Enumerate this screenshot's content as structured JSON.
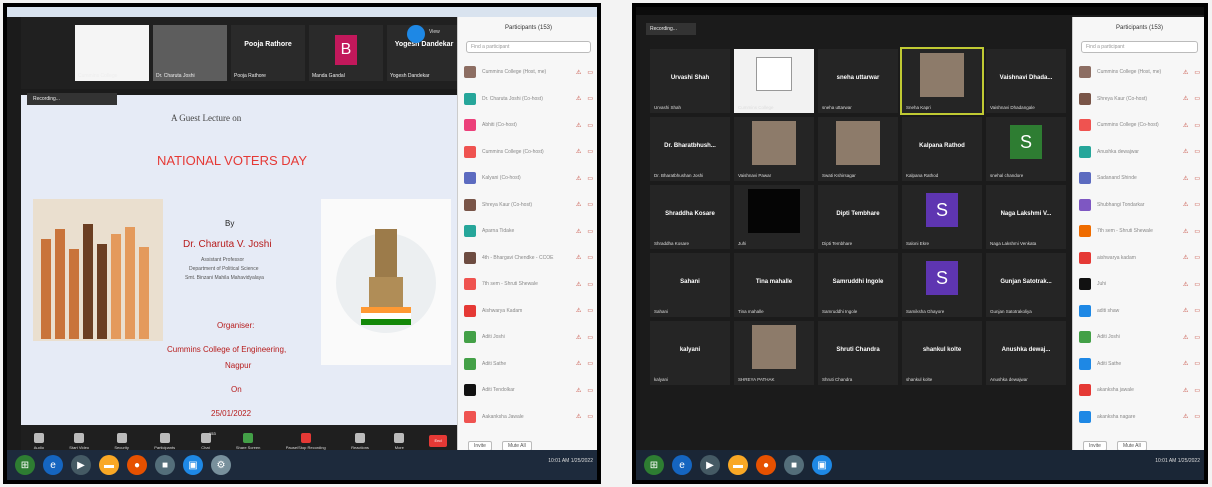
{
  "left": {
    "top_tiles": [
      {
        "name": "Cummins College",
        "big": ""
      },
      {
        "name": "Dr. Charuta Joshi",
        "big": ""
      },
      {
        "name": "Pooja Rathore",
        "big": "Pooja Rathore"
      },
      {
        "name": "Manda Gandal",
        "big": "B"
      },
      {
        "name": "Yogesh Dandekar",
        "big": "Yogesh Dandekar"
      }
    ],
    "view_label": "View",
    "recording_label": "Recording...",
    "slide": {
      "subtitle": "A Guest Lecture on",
      "title": "NATIONAL VOTERS DAY",
      "by": "By",
      "speaker": "Dr. Charuta V. Joshi",
      "designation": "Assistant Professor",
      "department": "Department of Political Science",
      "college": "Smt. Binzani Mahila Mahavidyalaya",
      "organiser_label": "Organiser:",
      "organiser": "Cummins College of Engineering,",
      "city": "Nagpur",
      "on": "On",
      "date": "25/01/2022"
    },
    "controls": [
      "Audio",
      "Start Video",
      "Security",
      "Participants",
      "Chat",
      "Share Screen",
      "Pause/Stop Recording",
      "Reactions",
      "More"
    ],
    "participants_count": "153",
    "end_label": "End",
    "panel": {
      "title": "Participants (153)",
      "search": "Find a participant",
      "rows": [
        {
          "name": "Cummins College (Host, me)",
          "color": "#8d6e63"
        },
        {
          "name": "Dr. Charuta Joshi (Co-host)",
          "color": "#26a69a"
        },
        {
          "name": "Abhiti (Co-host)",
          "color": "#ec407a"
        },
        {
          "name": "Cummins College (Co-host)",
          "color": "#ef5350"
        },
        {
          "name": "Kalyani (Co-host)",
          "color": "#5c6bc0"
        },
        {
          "name": "Shreya Kaur (Co-host)",
          "color": "#795548"
        },
        {
          "name": "Aparna Tidake",
          "color": "#26a69a"
        },
        {
          "name": "4th - Bhargavi Chendke - CCOE",
          "color": "#6d4c41"
        },
        {
          "name": "7th sem - Shruti Shewale",
          "color": "#ef5350"
        },
        {
          "name": "Aishwarya Kadam",
          "color": "#e53935"
        },
        {
          "name": "Aditi Joshi",
          "color": "#43a047"
        },
        {
          "name": "Aditi Sathe",
          "color": "#43a047"
        },
        {
          "name": "Aditi Tendolkar",
          "color": "#111111"
        },
        {
          "name": "Aakanksha Jawale",
          "color": "#ef5350"
        }
      ],
      "invite": "Invite",
      "mute_all": "Mute All"
    }
  },
  "right": {
    "recording_label": "Recording...",
    "grid": [
      {
        "big": "Urvashi Shah",
        "name": "Urvashi Shah",
        "kind": "text"
      },
      {
        "big": "",
        "name": "Cummins College",
        "kind": "logo"
      },
      {
        "big": "sneha uttarwar",
        "name": "sneha uttarwar",
        "kind": "text"
      },
      {
        "big": "",
        "name": "Sneha Kapri",
        "kind": "photo"
      },
      {
        "big": "Vaishnavi Dhada...",
        "name": "Vaishnavi Dhadangale",
        "kind": "text"
      },
      {
        "big": "Dr. Bharatbhush...",
        "name": "Dr. Bharatbhushan Joshi",
        "kind": "text"
      },
      {
        "big": "",
        "name": "Vaishnavi Pawar",
        "kind": "photo"
      },
      {
        "big": "",
        "name": "Swati Kshirsagar",
        "kind": "photo"
      },
      {
        "big": "Kalpana Rathod",
        "name": "Kalpana Rathod",
        "kind": "text"
      },
      {
        "big": "S",
        "name": "snehal chandore",
        "kind": "green"
      },
      {
        "big": "Shraddha Kosare",
        "name": "Shraddha Kosare",
        "kind": "text"
      },
      {
        "big": "",
        "name": "Juhi",
        "kind": "dark"
      },
      {
        "big": "Dipti Tembhare",
        "name": "Dipti Tembhare",
        "kind": "text"
      },
      {
        "big": "S",
        "name": "Saloni Ekre",
        "kind": "purple"
      },
      {
        "big": "Naga Lakshmi V...",
        "name": "Naga Lakshmi Venkata",
        "kind": "text"
      },
      {
        "big": "Sahani",
        "name": "Sahani",
        "kind": "text"
      },
      {
        "big": "Tina mahalle",
        "name": "Tina mahalle",
        "kind": "text"
      },
      {
        "big": "Samruddhi Ingole",
        "name": "Samruddhi Ingole",
        "kind": "text"
      },
      {
        "big": "S",
        "name": "Samiksha Ghayore",
        "kind": "purple"
      },
      {
        "big": "Gunjan Satotrak...",
        "name": "Gunjan Satotrakoliya",
        "kind": "text"
      },
      {
        "big": "kalyani",
        "name": "kalyani",
        "kind": "text"
      },
      {
        "big": "",
        "name": "SHREYA PATHAK",
        "kind": "photo"
      },
      {
        "big": "Shruti Chandra",
        "name": "Shruti Chandra",
        "kind": "text"
      },
      {
        "big": "shankul kolte",
        "name": "shankul kolte",
        "kind": "text"
      },
      {
        "big": "Anushka dewaj...",
        "name": "Anushka dewajwar",
        "kind": "text"
      }
    ],
    "panel": {
      "title": "Participants (153)",
      "search": "Find a participant",
      "rows": [
        {
          "name": "Cummins College (Host, me)",
          "color": "#8d6e63"
        },
        {
          "name": "Shreya Kaur (Co-host)",
          "color": "#795548"
        },
        {
          "name": "Cummins College (Co-host)",
          "color": "#ef5350"
        },
        {
          "name": "Anushka dewajwar",
          "color": "#26a69a"
        },
        {
          "name": "Sadanand Shinde",
          "color": "#5c6bc0"
        },
        {
          "name": "Shubhangi Tondarkar",
          "color": "#7e57c2"
        },
        {
          "name": "7th sem - Shruti Shewale",
          "color": "#ef6c00"
        },
        {
          "name": "aishwarya kadam",
          "color": "#e53935"
        },
        {
          "name": "Juhi",
          "color": "#111111"
        },
        {
          "name": "aditi shaw",
          "color": "#1e88e5"
        },
        {
          "name": "Aditi Joshi",
          "color": "#43a047"
        },
        {
          "name": "Aditi Sathe",
          "color": "#1e88e5"
        },
        {
          "name": "akanksha jawale",
          "color": "#e53935"
        },
        {
          "name": "akanksha nagare",
          "color": "#1e88e5"
        }
      ],
      "invite": "Invite",
      "mute_all": "Mute All"
    }
  },
  "taskbar": {
    "time": "10:01 AM",
    "date": "1/25/2022"
  }
}
